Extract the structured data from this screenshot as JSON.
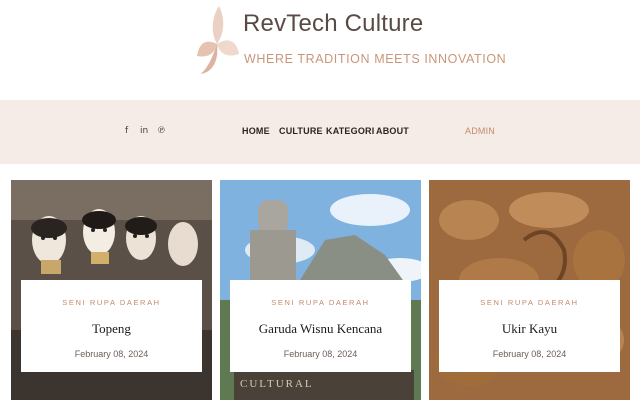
{
  "brand": {
    "title": "RevTech Culture",
    "tagline": "WHERE TRADITION MEETS INNOVATION"
  },
  "social": [
    {
      "icon": "facebook-icon",
      "glyph": "f"
    },
    {
      "icon": "linkedin-icon",
      "glyph": "in"
    },
    {
      "icon": "pinterest-icon",
      "glyph": "℗"
    }
  ],
  "nav": {
    "items": [
      "HOME",
      "CULTURE",
      "KATEGORI",
      "ABOUT"
    ],
    "admin": "ADMIN"
  },
  "colors": {
    "nav_background": "#f6ece7",
    "accent": "#c48a6b",
    "logo_petal": "#e8c9b8"
  },
  "cards": [
    {
      "category": "SENI RUPA DAERAH",
      "title": "Topeng",
      "date": "February 08, 2024"
    },
    {
      "category": "SENI RUPA DAERAH",
      "title": "Garuda Wisnu Kencana",
      "date": "February 08, 2024"
    },
    {
      "category": "SENI RUPA DAERAH",
      "title": "Ukir Kayu",
      "date": "February 08, 2024"
    }
  ]
}
